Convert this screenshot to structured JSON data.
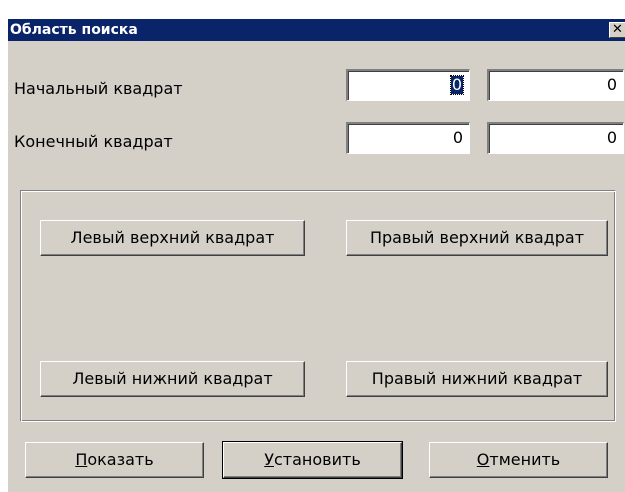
{
  "window": {
    "title": "Область поиска",
    "close_glyph": "✕"
  },
  "fields": {
    "start_label": "Начальный квадрат",
    "start_x": "0",
    "start_y": "0",
    "end_label": "Конечный квадрат",
    "end_x": "0",
    "end_y": "0"
  },
  "corners": {
    "top_left": "Левый верхний квадрат",
    "top_right": "Правый верхний квадрат",
    "bottom_left": "Левый нижний квадрат",
    "bottom_right": "Правый нижний квадрат"
  },
  "footer": {
    "show_hotkey": "П",
    "show_rest": "оказать",
    "set_hotkey": "У",
    "set_rest": "становить",
    "cancel_hotkey": "О",
    "cancel_rest": "тменить"
  },
  "colors": {
    "titlebar": "#0a246a",
    "face": "#d4d0c8"
  }
}
